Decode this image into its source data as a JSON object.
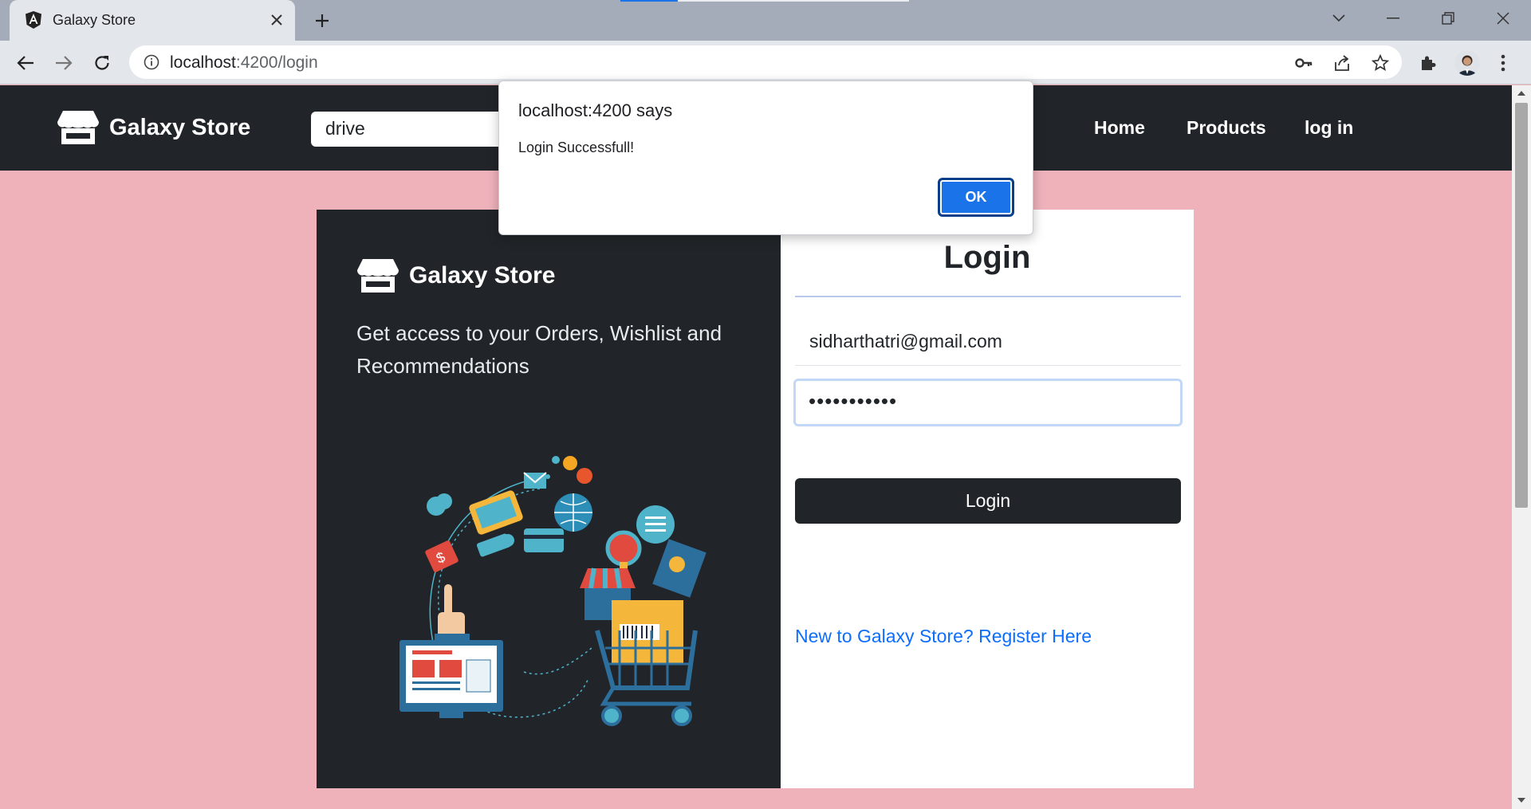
{
  "browser": {
    "tab_title": "Galaxy Store",
    "url_host": "localhost",
    "url_path": ":4200/login"
  },
  "navbar": {
    "brand": "Galaxy Store",
    "search_value": "drive",
    "links": [
      "Home",
      "Products",
      "log in"
    ]
  },
  "promo": {
    "brand": "Galaxy Store",
    "tagline": "Get access to your Orders, Wishlist and Recommendations"
  },
  "login": {
    "title": "Login",
    "email_value": "sidharthatri@gmail.com",
    "password_value": "•••••••••••",
    "submit_label": "Login",
    "register_link": "New to Galaxy Store? Register Here"
  },
  "dialog": {
    "title": "localhost:4200 says",
    "message": "Login Successfull!",
    "ok_label": "OK"
  },
  "colors": {
    "page_background": "#efb2bb",
    "navbar": "#212529",
    "link": "#0d6efd",
    "dialog_button": "#1a73e8"
  }
}
